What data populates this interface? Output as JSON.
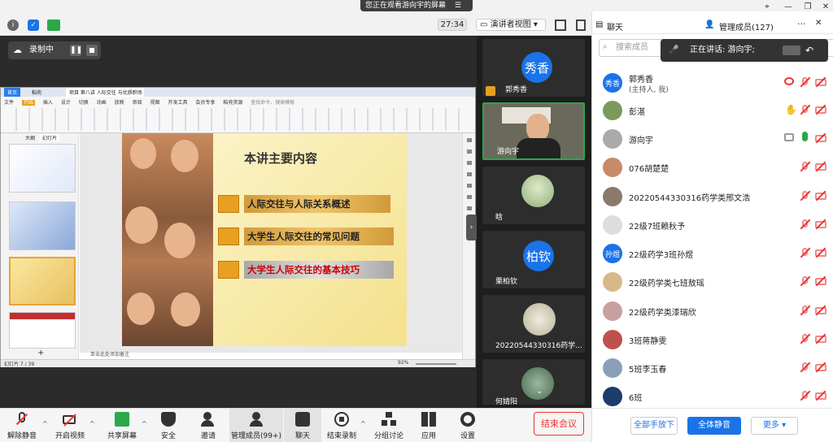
{
  "banner": {
    "text": "您正在观看游向宇的屏幕"
  },
  "topbar": {
    "timer": "27:34",
    "presenter_view": "演讲者视图"
  },
  "recording": {
    "label": "录制中"
  },
  "ppt": {
    "tab_home": "首页",
    "tab_file": "稻壳",
    "tab_doc": "项目 第八讲 人际交往 与优质职场 .pptx",
    "tab_start": "开始",
    "menus": [
      "文件",
      "开始",
      "插入",
      "设计",
      "切换",
      "动画",
      "放映",
      "审阅",
      "视图",
      "开发工具",
      "会员专享",
      "稻壳资源"
    ],
    "search_hint": "查找命令、搜索模板",
    "outline_tab": "大纲",
    "slides_tab": "幻灯片",
    "status_left": "幻灯片 7 / 39",
    "status_notes": "单击此处添加备注",
    "zoom": "92%",
    "add_slide": "+"
  },
  "slide": {
    "title": "本讲主要内容",
    "items": [
      {
        "text": "人际交往与人际关系概述",
        "style": "gold"
      },
      {
        "text": "大学生人际交往的常见问题",
        "style": "gold"
      },
      {
        "text": "大学生人际交往的基本技巧",
        "style": "grey"
      }
    ]
  },
  "videos": [
    {
      "name": "郭秀香",
      "avatar_text": "秀香",
      "kind": "avatar"
    },
    {
      "name": "游向宇",
      "kind": "camera"
    },
    {
      "name": "晗",
      "kind": "photo"
    },
    {
      "name": "栗柏钦",
      "avatar_text": "柏钦",
      "kind": "avatar"
    },
    {
      "name": "20220544330316药学...",
      "kind": "photo"
    },
    {
      "name": "何婧阳",
      "kind": "photo"
    }
  ],
  "panel": {
    "tab_chat": "聊天",
    "tab_members": "管理成员(127)",
    "search_placeholder": "搜索成员",
    "speaking": "正在讲话: 游向宇;",
    "members": [
      {
        "name": "郭秀香",
        "sub": "(主持人, 我)",
        "avatar": "秀香",
        "color": "#1a73e8"
      },
      {
        "name": "彭湛",
        "sub": "",
        "avatar": "",
        "color": "#7a9a5c"
      },
      {
        "name": "游向宇",
        "sub": "",
        "avatar": "",
        "color": "#aaa"
      },
      {
        "name": "076胡楚楚",
        "sub": "",
        "avatar": "",
        "color": "#c98a6c"
      },
      {
        "name": "20220544330316药学类邢文浩",
        "sub": "",
        "avatar": "",
        "color": "#8a7a6a"
      },
      {
        "name": "22级7班赖秋予",
        "sub": "",
        "avatar": "",
        "color": "#ddd"
      },
      {
        "name": "22级药学3班孙煜",
        "sub": "",
        "avatar": "孙煜",
        "color": "#1a73e8"
      },
      {
        "name": "22级药学类七班敖瑶",
        "sub": "",
        "avatar": "",
        "color": "#d8b88a"
      },
      {
        "name": "22级药学类漆瑞欣",
        "sub": "",
        "avatar": "",
        "color": "#c9a0a0"
      },
      {
        "name": "3班蒋静雯",
        "sub": "",
        "avatar": "",
        "color": "#c0504d"
      },
      {
        "name": "5班李玉春",
        "sub": "",
        "avatar": "",
        "color": "#8aa0b8"
      },
      {
        "name": "6班",
        "sub": "",
        "avatar": "",
        "color": "#1c3c6c"
      }
    ],
    "btn_all_down": "全部手放下",
    "btn_mute_all": "全体静音",
    "btn_more": "更多"
  },
  "toolbar": {
    "unmute": "解除静音",
    "video": "开启视频",
    "share": "共享屏幕",
    "security": "安全",
    "invite": "邀请",
    "members": "管理成员(99+)",
    "chat": "聊天",
    "end_record": "结束录制",
    "breakout": "分组讨论",
    "apps": "应用",
    "settings": "设置",
    "end_meeting": "结束会议"
  }
}
